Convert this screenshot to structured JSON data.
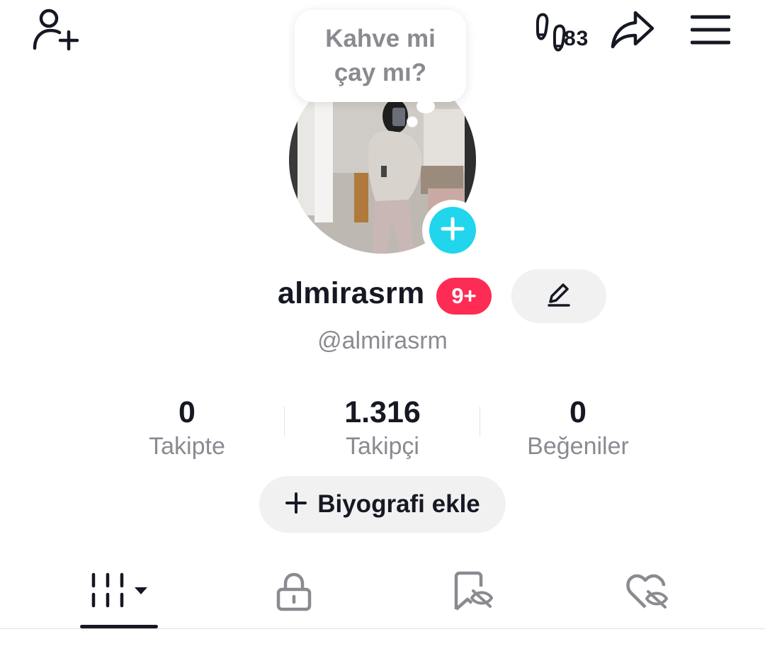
{
  "header": {
    "add_friend_icon": "person-plus-icon",
    "footprint_icon": "footprints-icon",
    "footprint_count": "83",
    "share_icon": "share-arrow-icon",
    "menu_icon": "hamburger-menu-icon"
  },
  "profile": {
    "note_line1": "Kahve mi",
    "note_line2": "çay mı?",
    "display_name": "almirasrm",
    "notification_badge": "9+",
    "handle": "@almirasrm",
    "edit_icon": "pencil-icon",
    "avatar_add_icon": "plus-icon"
  },
  "stats": [
    {
      "value": "0",
      "label": "Takipte"
    },
    {
      "value": "1.316",
      "label": "Takipçi"
    },
    {
      "value": "0",
      "label": "Beğeniler"
    }
  ],
  "bio_button": {
    "icon": "plus-icon",
    "label": "Biyografi ekle"
  },
  "tabs": [
    {
      "icon": "video-grid-icon",
      "active": true
    },
    {
      "icon": "lock-icon",
      "active": false
    },
    {
      "icon": "bookmark-hidden-icon",
      "active": false
    },
    {
      "icon": "heart-hidden-icon",
      "active": false
    }
  ],
  "colors": {
    "accent_cyan": "#20d5ec",
    "badge_red": "#fe2c55",
    "text_primary": "#161823",
    "text_secondary": "#8a8b91",
    "button_bg": "#f1f1f2"
  }
}
